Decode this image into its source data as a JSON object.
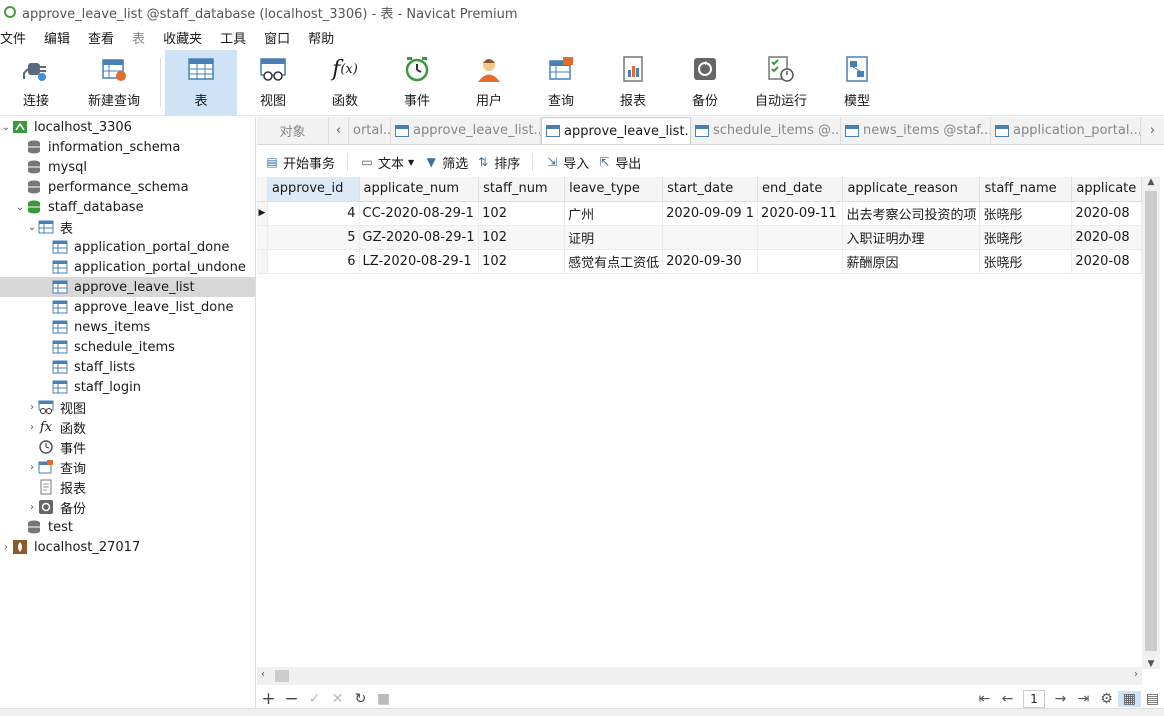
{
  "window": {
    "title": "approve_leave_list @staff_database (localhost_3306) - 表 - Navicat Premium"
  },
  "menu": {
    "items": [
      "文件",
      "编辑",
      "查看",
      "表",
      "收藏夹",
      "工具",
      "窗口",
      "帮助"
    ]
  },
  "toolbar": {
    "items": [
      {
        "label": "连接",
        "icon": "plug-icon"
      },
      {
        "label": "新建查询",
        "icon": "new-query-icon"
      },
      {
        "label": "表",
        "icon": "table-icon",
        "active": true
      },
      {
        "label": "视图",
        "icon": "view-icon"
      },
      {
        "label": "函数",
        "icon": "function-icon"
      },
      {
        "label": "事件",
        "icon": "clock-icon"
      },
      {
        "label": "用户",
        "icon": "user-icon"
      },
      {
        "label": "查询",
        "icon": "query-icon"
      },
      {
        "label": "报表",
        "icon": "report-icon"
      },
      {
        "label": "备份",
        "icon": "backup-icon"
      },
      {
        "label": "自动运行",
        "icon": "schedule-icon"
      },
      {
        "label": "模型",
        "icon": "model-icon"
      }
    ]
  },
  "sidebar": {
    "items": [
      {
        "label": "localhost_3306",
        "level": 0,
        "arrow": "v",
        "icon": "server"
      },
      {
        "label": "information_schema",
        "level": 1,
        "arrow": "",
        "icon": "db"
      },
      {
        "label": "mysql",
        "level": 1,
        "arrow": "",
        "icon": "db"
      },
      {
        "label": "performance_schema",
        "level": 1,
        "arrow": "",
        "icon": "db"
      },
      {
        "label": "staff_database",
        "level": 1,
        "arrow": "v",
        "icon": "db-green"
      },
      {
        "label": "表",
        "level": 2,
        "arrow": "v",
        "icon": "table"
      },
      {
        "label": "application_portal_done",
        "level": 3,
        "arrow": "",
        "icon": "table"
      },
      {
        "label": "application_portal_undone",
        "level": 3,
        "arrow": "",
        "icon": "table"
      },
      {
        "label": "approve_leave_list",
        "level": 3,
        "arrow": "",
        "icon": "table",
        "selected": true
      },
      {
        "label": "approve_leave_list_done",
        "level": 3,
        "arrow": "",
        "icon": "table"
      },
      {
        "label": "news_items",
        "level": 3,
        "arrow": "",
        "icon": "table"
      },
      {
        "label": "schedule_items",
        "level": 3,
        "arrow": "",
        "icon": "table"
      },
      {
        "label": "staff_lists",
        "level": 3,
        "arrow": "",
        "icon": "table"
      },
      {
        "label": "staff_login",
        "level": 3,
        "arrow": "",
        "icon": "table"
      },
      {
        "label": "视图",
        "level": 2,
        "arrow": ">",
        "icon": "view"
      },
      {
        "label": "函数",
        "level": 2,
        "arrow": ">",
        "icon": "func"
      },
      {
        "label": "事件",
        "level": 2,
        "arrow": "",
        "icon": "event"
      },
      {
        "label": "查询",
        "level": 2,
        "arrow": ">",
        "icon": "query"
      },
      {
        "label": "报表",
        "level": 2,
        "arrow": "",
        "icon": "report"
      },
      {
        "label": "备份",
        "level": 2,
        "arrow": ">",
        "icon": "backup"
      },
      {
        "label": "test",
        "level": 1,
        "arrow": "",
        "icon": "db"
      },
      {
        "label": "localhost_27017",
        "level": 0,
        "arrow": ">",
        "icon": "mongo"
      }
    ]
  },
  "tabs": {
    "objects_label": "对象",
    "items": [
      {
        "label": "ortal...",
        "active": false,
        "icon": false
      },
      {
        "label": "approve_leave_list...",
        "active": false,
        "icon": true
      },
      {
        "label": "approve_leave_list...",
        "active": true,
        "icon": true
      },
      {
        "label": "schedule_items @...",
        "active": false,
        "icon": true
      },
      {
        "label": "news_items @staf...",
        "active": false,
        "icon": true
      },
      {
        "label": "application_portal...",
        "active": false,
        "icon": true
      }
    ]
  },
  "actions": [
    {
      "label": "开始事务",
      "icon": "transaction-icon"
    },
    {
      "label": "文本",
      "icon": "text-icon"
    },
    {
      "label": "筛选",
      "icon": "filter-icon"
    },
    {
      "label": "排序",
      "icon": "sort-icon"
    },
    {
      "label": "导入",
      "icon": "import-icon"
    },
    {
      "label": "导出",
      "icon": "export-icon"
    }
  ],
  "grid": {
    "columns": [
      "approve_id",
      "applicate_num",
      "staff_num",
      "leave_type",
      "start_date",
      "end_date",
      "applicate_reason",
      "staff_name",
      "applicate"
    ],
    "rows": [
      [
        "4",
        "CC-2020-08-29-1",
        "102",
        "广州",
        "2020-09-09 1",
        "2020-09-11",
        "出去考察公司投资的项",
        "张晓彤",
        "2020-08"
      ],
      [
        "5",
        "GZ-2020-08-29-1",
        "102",
        "证明",
        "",
        "",
        "入职证明办理",
        "张晓彤",
        "2020-08"
      ],
      [
        "6",
        "LZ-2020-08-29-1",
        "102",
        "感觉有点工资低",
        "2020-09-30",
        "",
        "薪酬原因",
        "张晓彤",
        "2020-08"
      ]
    ]
  },
  "pager": {
    "page": "1"
  }
}
